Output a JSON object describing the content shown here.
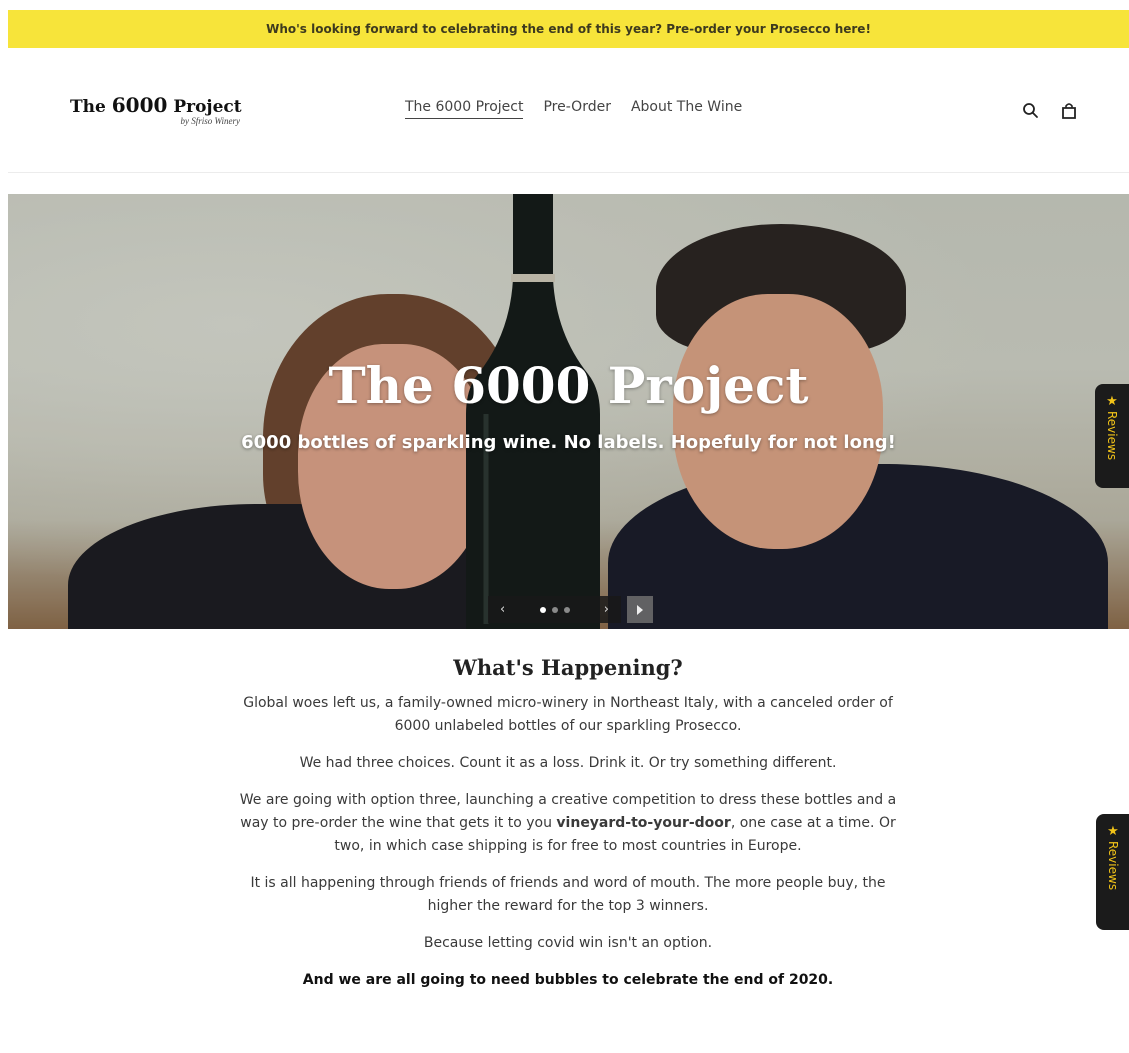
{
  "announcement": "Who's looking forward to celebrating the end of this year? Pre-order your Prosecco here!",
  "logo": {
    "line1_pre": "The",
    "line1_number": "6000",
    "line1_post": "Project",
    "line2": "by Sfriso Winery"
  },
  "nav": {
    "items": [
      {
        "label": "The 6000 Project"
      },
      {
        "label": "Pre-Order"
      },
      {
        "label": "About The Wine"
      }
    ]
  },
  "header_icons": [
    "search-icon",
    "cart-icon"
  ],
  "hero": {
    "title": "The 6000 Project",
    "subtitle": "6000 bottles of sparkling wine. No labels. Hopefuly for not long!",
    "slider": {
      "prev": "‹",
      "next": "›",
      "slides": 3,
      "active_slide": 1
    }
  },
  "reviews_tab": {
    "label": "Reviews"
  },
  "content": {
    "heading": "What's Happening?",
    "p1": "Global woes left us, a family-owned micro-winery in Northeast Italy, with a canceled order of 6000 unlabeled bottles of our sparkling Prosecco.",
    "p2": "We had three choices. Count it as a loss. Drink it. Or try something different.",
    "p3_a": "We are going with option three, launching a creative competition to dress these bottles and a way to pre-order the wine that gets it to you ",
    "p3_bold": "vineyard-to-your-door",
    "p3_b": ", one case at a time. Or two, in which case shipping is for free to most countries in Europe.",
    "p4": "It is all happening through friends of friends and word of mouth. The more people buy, the higher the reward for the top 3 winners.",
    "p5": "Because letting covid win isn't an option.",
    "p6": "And we are all going to need bubbles to celebrate the end of 2020."
  },
  "colors": {
    "announcement_bg": "#f7e43a",
    "reviews_bg": "#1b1b1b",
    "reviews_fg": "#f2c318"
  }
}
